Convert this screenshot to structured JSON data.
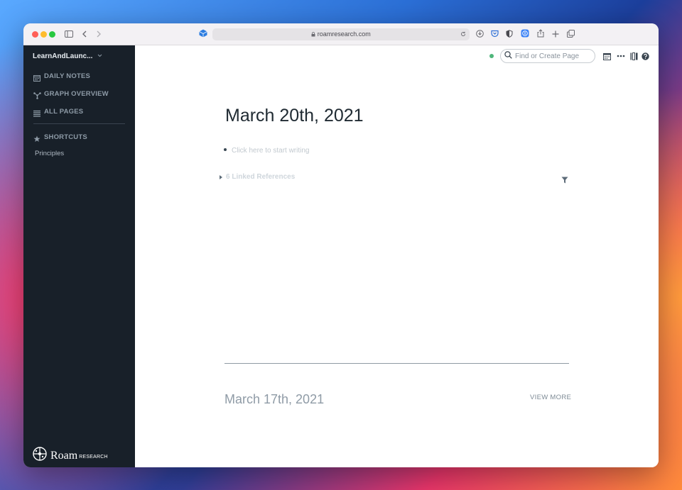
{
  "browser": {
    "url": "roamresearch.com",
    "colors": {
      "close": "#ff5f57",
      "minimize": "#febc2e",
      "zoom": "#28c840"
    }
  },
  "sidebar": {
    "graph_name": "LearnAndLaunc...",
    "nav": [
      {
        "label": "DAILY NOTES",
        "icon": "calendar-icon"
      },
      {
        "label": "GRAPH OVERVIEW",
        "icon": "graph-icon"
      },
      {
        "label": "ALL PAGES",
        "icon": "list-icon"
      },
      {
        "label": "SHORTCUTS",
        "icon": "star-icon"
      }
    ],
    "shortcuts": [
      "Principles"
    ],
    "logo": {
      "word": "Roam",
      "sub": "RESEARCH"
    }
  },
  "toolbar": {
    "search_placeholder": "Find or Create Page"
  },
  "page": {
    "title": "March 20th, 2021",
    "block_placeholder": "Click here to start writing",
    "linked_references": "6 Linked References"
  },
  "previous": {
    "title": "March 17th, 2021",
    "view_more": "VIEW MORE"
  }
}
